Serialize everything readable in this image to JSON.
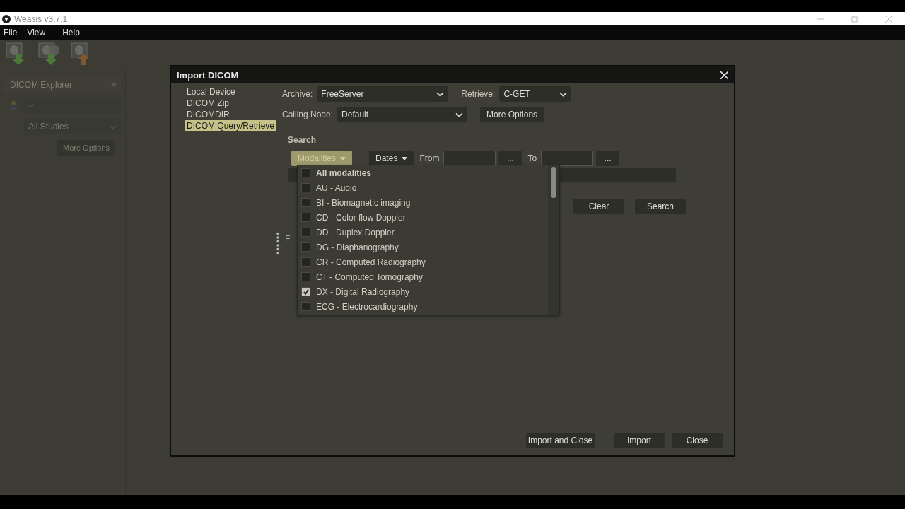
{
  "window": {
    "title": "Weasis v3.7.1"
  },
  "menu": [
    "File",
    "View",
    "Help"
  ],
  "toolbar": [
    {
      "kind": "import"
    },
    {
      "kind": "import_disc"
    },
    {
      "kind": "export"
    }
  ],
  "explorer": {
    "title": "DICOM Explorer",
    "studies": "All Studies",
    "more_options": "More Options"
  },
  "dialog": {
    "title": "Import DICOM",
    "sources": [
      {
        "label": "Local Device",
        "selected": false
      },
      {
        "label": "DICOM Zip",
        "selected": false
      },
      {
        "label": "DICOMDIR",
        "selected": false
      },
      {
        "label": "DICOM Query/Retrieve",
        "selected": true
      }
    ],
    "archive_label": "Archive:",
    "archive": "FreeServer",
    "retrieve_label": "Retrieve:",
    "retrieve": "C-GET",
    "calling_node_label": "Calling Node:",
    "calling_node": "Default",
    "more_options": "More Options",
    "search_title": "Search",
    "modalities": "Modalities",
    "modalities_open": true,
    "dates": "Dates",
    "from_label": "From",
    "from_browse": "...",
    "to_label": "To",
    "to_browse": "...",
    "clear": "Clear",
    "search": "Search",
    "partial_label": "F",
    "modality_options": [
      {
        "kind": "all",
        "label": "All modalities",
        "checked": false
      },
      {
        "kind": "item",
        "label": "AU - Audio",
        "checked": false
      },
      {
        "kind": "item",
        "label": "BI - Biomagnetic imaging",
        "checked": false
      },
      {
        "kind": "item",
        "label": "CD - Color flow Doppler",
        "checked": false
      },
      {
        "kind": "item",
        "label": "DD - Duplex Doppler",
        "checked": false
      },
      {
        "kind": "item",
        "label": "DG - Diaphanography",
        "checked": false
      },
      {
        "kind": "item",
        "label": "CR - Computed Radiography",
        "checked": false
      },
      {
        "kind": "item",
        "label": "CT - Computed Tomography",
        "checked": false
      },
      {
        "kind": "item",
        "label": "DX - Digital Radiography",
        "checked": true
      },
      {
        "kind": "item",
        "label": "ECG - Electrocardiography",
        "checked": false
      }
    ],
    "buttons": [
      "Import and Close",
      "Import",
      "Close"
    ]
  }
}
